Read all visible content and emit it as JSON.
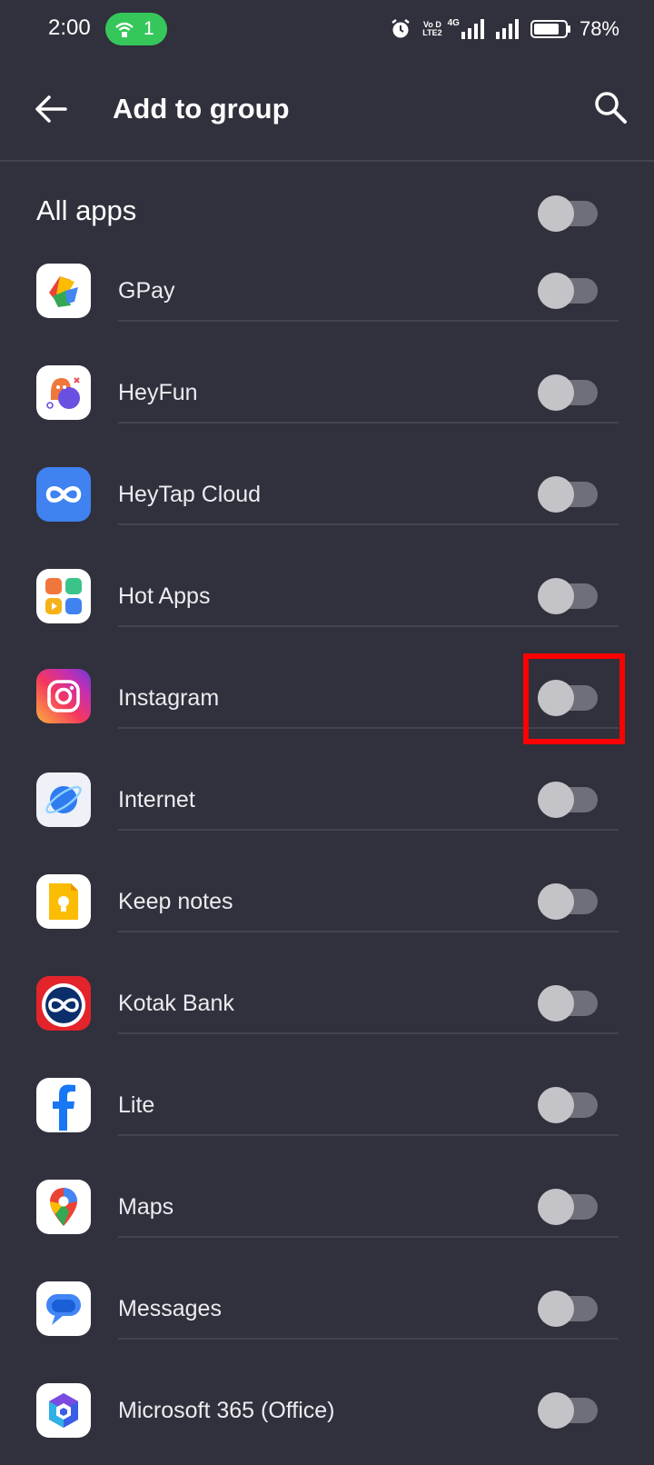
{
  "status_bar": {
    "time": "2:00",
    "hotspot_count": "1",
    "volte_top": "Vo D",
    "volte_bottom": "LTE2",
    "network": "4G",
    "battery": "78%"
  },
  "header": {
    "title": "Add to group",
    "back_icon": "arrow-left-icon",
    "search_icon": "search-icon"
  },
  "all_apps": {
    "label": "All apps",
    "enabled": false
  },
  "apps": [
    {
      "label": "GPay",
      "icon": "gpay-icon",
      "enabled": false
    },
    {
      "label": "HeyFun",
      "icon": "heyfun-icon",
      "enabled": false
    },
    {
      "label": "HeyTap Cloud",
      "icon": "heytap-cloud-icon",
      "enabled": false
    },
    {
      "label": "Hot Apps",
      "icon": "hot-apps-icon",
      "enabled": false
    },
    {
      "label": "Instagram",
      "icon": "instagram-icon",
      "enabled": false
    },
    {
      "label": "Internet",
      "icon": "internet-icon",
      "enabled": false
    },
    {
      "label": "Keep notes",
      "icon": "keep-notes-icon",
      "enabled": false
    },
    {
      "label": "Kotak Bank",
      "icon": "kotak-bank-icon",
      "enabled": false
    },
    {
      "label": "Lite",
      "icon": "facebook-lite-icon",
      "enabled": false
    },
    {
      "label": "Maps",
      "icon": "maps-icon",
      "enabled": false
    },
    {
      "label": "Messages",
      "icon": "messages-icon",
      "enabled": false
    },
    {
      "label": "Microsoft 365 (Office)",
      "icon": "microsoft-365-icon",
      "enabled": false
    }
  ],
  "colors": {
    "background": "#30313c",
    "divider": "#43444f",
    "toggle_track": "#6e6f78",
    "toggle_knob": "#c4c4c8",
    "highlight": "#ff0000",
    "hotspot": "#36c75a"
  }
}
